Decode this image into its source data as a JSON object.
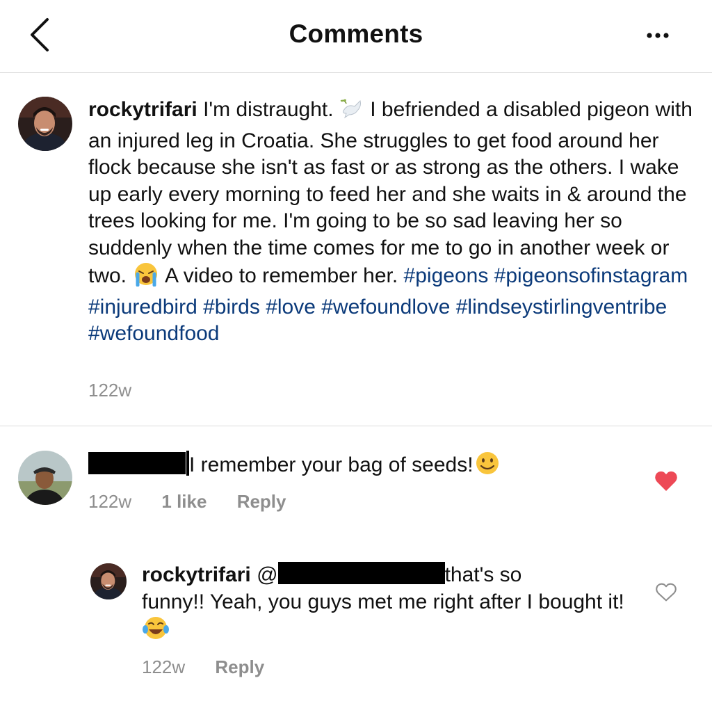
{
  "header": {
    "title": "Comments",
    "back_icon": "chevron-left-icon",
    "more_icon": "ellipsis-icon"
  },
  "caption": {
    "username": "rockytrifari",
    "text_1": " I'm distraught. ",
    "emoji_1": "dove-icon",
    "text_2": " I befriended a disabled pigeon with an injured leg in Croatia. She struggles to get food around her flock because she isn't as fast or as strong as the others. I wake up early every morning to feed her and she waits in & around the trees looking for me. I'm going to be so sad leaving her so suddenly when the time comes for me to go in another week or two. ",
    "emoji_2": "crying-face-icon",
    "text_3": " A video to remember her. ",
    "hashtags": [
      "#pigeons",
      "#pigeonsofinstagram",
      "#injuredbird",
      "#birds",
      "#love",
      "#wefoundlove",
      "#lindseystirlingventribe",
      "#wefoundfood"
    ],
    "time": "122w"
  },
  "comment_1": {
    "text": "I remember your bag of seeds!",
    "emoji": "smiling-face-icon",
    "time": "122w",
    "likes": "1 like",
    "reply_label": "Reply",
    "liked": true,
    "like_color": "#ed4956"
  },
  "reply_1": {
    "username": "rockytrifari",
    "mention_prefix": "@",
    "text_1": "that's so",
    "text_2": "funny!! Yeah, you guys met me right after I bought it! ",
    "emoji": "tears-of-joy-icon",
    "time": "122w",
    "reply_label": "Reply",
    "liked": false
  },
  "colors": {
    "hashtag": "#0b3a7a",
    "meta": "#8e8e8e",
    "divider": "#dbdbdb"
  }
}
